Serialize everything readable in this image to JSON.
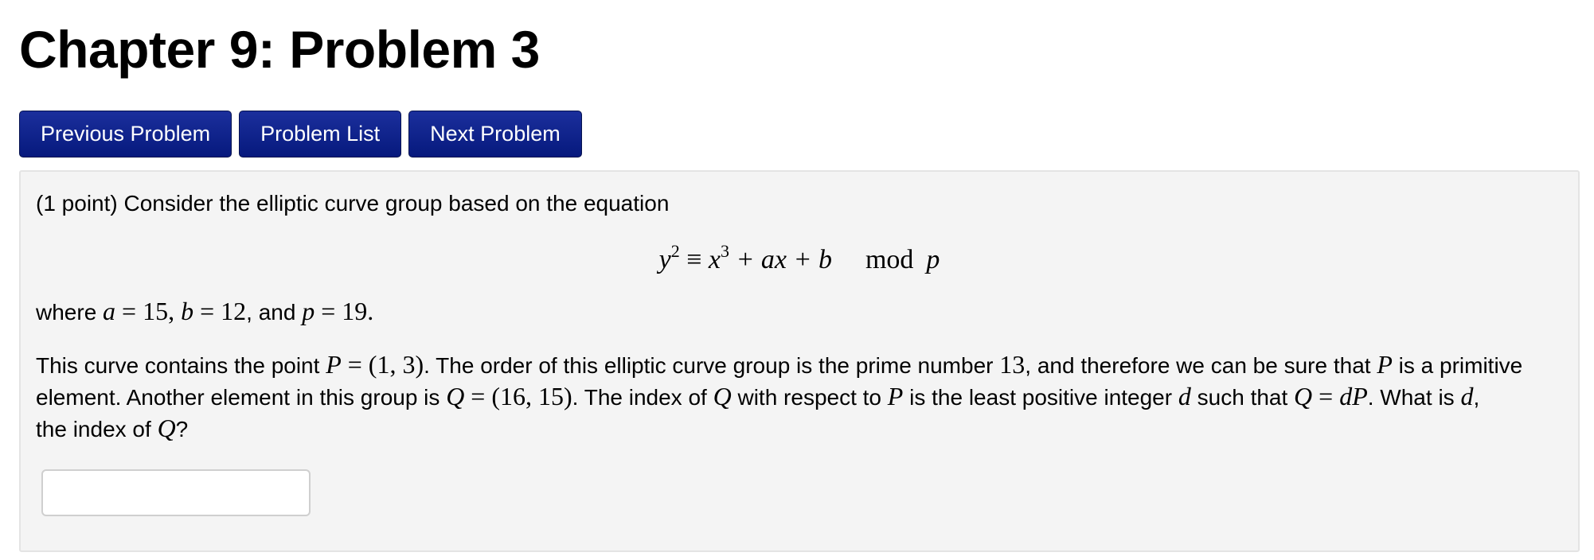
{
  "header": {
    "title": "Chapter 9: Problem 3"
  },
  "nav": {
    "previous_label": "Previous Problem",
    "list_label": "Problem List",
    "next_label": "Next Problem"
  },
  "problem": {
    "intro": "(1 point) Consider the elliptic curve group based on the equation",
    "equation": {
      "y": "y",
      "y_exp": "2",
      "equiv": " ≡ ",
      "x": "x",
      "x_exp": "3",
      "rest": " + ax + b",
      "mod": "mod",
      "p": "p"
    },
    "params": {
      "where": "where ",
      "a_var": "a",
      "a_eq": " = 15",
      "sep1": ", ",
      "b_var": "b",
      "b_eq": " = 12",
      "sep2": ", and ",
      "p_var": "p",
      "p_eq": " = 19",
      "end": "."
    },
    "line1": {
      "t1": "This curve contains the point ",
      "P": "P",
      "m1": " = (1, 3)",
      "t2": ". The order of this elliptic curve group is the prime number ",
      "m2": "13",
      "t3": ", and therefore we can be sure that ",
      "P2": "P",
      "t4": " is a primitive"
    },
    "line2": {
      "t1": "element. Another element in this group is ",
      "Q": "Q",
      "m1": " = (16, 15)",
      "t2": ". The index of ",
      "Q2": "Q",
      "t3": " with respect to ",
      "P": "P",
      "t4": " is the least positive integer ",
      "d": "d",
      "t5": " such that ",
      "Q3": "Q",
      "eq": " = ",
      "dP": "dP",
      "t6": ". What is ",
      "d2": "d",
      "t7": ","
    },
    "line3": {
      "t1": "the index of ",
      "Q": "Q",
      "t2": "?"
    },
    "answer": {
      "value": "",
      "placeholder": ""
    }
  }
}
